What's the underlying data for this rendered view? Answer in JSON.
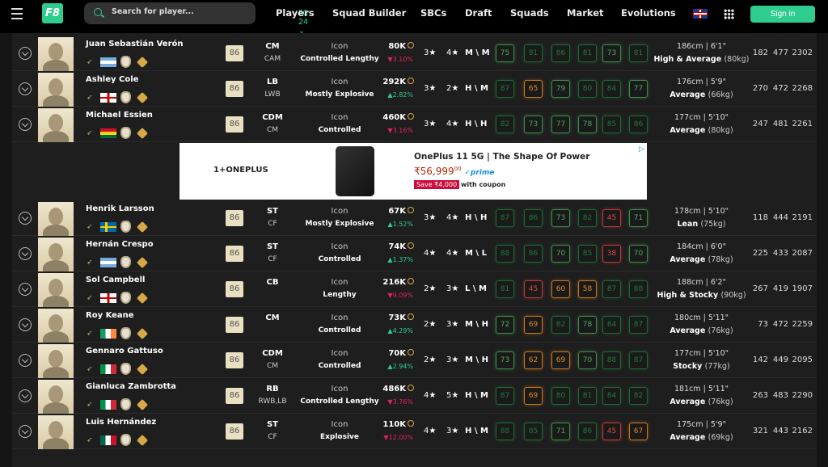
{
  "nav": {
    "logo": "F8",
    "search_placeholder": "Search for player...",
    "game": "FC 24",
    "links": [
      "Players",
      "Squad Builder",
      "SBCs",
      "Draft",
      "Squads",
      "Market",
      "Evolutions"
    ],
    "signin": "Sign in"
  },
  "colors": {
    "accent": "#2ecc8f",
    "up": "#2ecc8f",
    "down": "#e0245e",
    "stat_high": "#1e7a3a",
    "stat_good": "#4cab5a",
    "stat_mid": "#e08a25",
    "stat_low": "#e04848"
  },
  "ad": {
    "brand": "1+ONEPLUS",
    "title": "OnePlus 11 5G | The Shape Of Power",
    "price": "₹56,999",
    "price_cents": "00",
    "prime": "✓prime",
    "save": "Save ₹4,000",
    "coupon": "with coupon",
    "choices": "▷"
  },
  "players": [
    {
      "name": "Juan Sebastián Verón",
      "flag": "ar",
      "rating": "86",
      "pos": "CM",
      "alt": "CAM",
      "card": "Icon",
      "style": "Controlled Lengthy",
      "price": "80K",
      "change": "3.10%",
      "dir": "down",
      "skill": "3★",
      "weak": "4★",
      "wr": "M \\ M",
      "stats": [
        75,
        81,
        86,
        81,
        73,
        81
      ],
      "height": "186cm | 6'1\"",
      "body": "High & Average",
      "weight": "(80kg)",
      "n": [
        "182",
        "477",
        "2302"
      ]
    },
    {
      "name": "Ashley Cole",
      "flag": "en",
      "rating": "86",
      "pos": "LB",
      "alt": "LWB",
      "card": "Icon",
      "style": "Mostly Explosive",
      "price": "292K",
      "change": "2.82%",
      "dir": "up",
      "skill": "3★",
      "weak": "2★",
      "wr": "H \\ M",
      "stats": [
        87,
        65,
        79,
        80,
        84,
        77
      ],
      "height": "176cm | 5'9\"",
      "body": "Average",
      "weight": "(66kg)",
      "n": [
        "270",
        "472",
        "2268"
      ]
    },
    {
      "name": "Michael Essien",
      "flag": "gh",
      "rating": "86",
      "pos": "CDM",
      "alt": "CM",
      "card": "Icon",
      "style": "Controlled",
      "price": "460K",
      "change": "3.16%",
      "dir": "down",
      "skill": "3★",
      "weak": "4★",
      "wr": "H \\ H",
      "stats": [
        82,
        73,
        77,
        78,
        85,
        86
      ],
      "height": "177cm | 5'10\"",
      "body": "Average",
      "weight": "(80kg)",
      "n": [
        "247",
        "481",
        "2261"
      ]
    },
    {
      "name": "Henrik Larsson",
      "flag": "se",
      "rating": "86",
      "pos": "ST",
      "alt": "CF",
      "card": "Icon",
      "style": "Mostly Explosive",
      "price": "67K",
      "change": "1.52%",
      "dir": "up",
      "skill": "3★",
      "weak": "4★",
      "wr": "H \\ H",
      "stats": [
        87,
        86,
        73,
        82,
        45,
        71
      ],
      "height": "178cm | 5'10\"",
      "body": "Lean",
      "weight": "(75kg)",
      "n": [
        "118",
        "444",
        "2191"
      ]
    },
    {
      "name": "Hernán Crespo",
      "flag": "ar",
      "rating": "86",
      "pos": "ST",
      "alt": "CF",
      "card": "Icon",
      "style": "Controlled",
      "price": "74K",
      "change": "1.37%",
      "dir": "up",
      "skill": "4★",
      "weak": "4★",
      "wr": "M \\ L",
      "stats": [
        88,
        86,
        70,
        85,
        38,
        70
      ],
      "height": "184cm | 6'0\"",
      "body": "Average",
      "weight": "(78kg)",
      "n": [
        "225",
        "433",
        "2087"
      ]
    },
    {
      "name": "Sol Campbell",
      "flag": "en",
      "rating": "86",
      "pos": "CB",
      "alt": "",
      "card": "Icon",
      "style": "Lengthy",
      "price": "216K",
      "change": "9.09%",
      "dir": "down",
      "skill": "2★",
      "weak": "3★",
      "wr": "L \\ M",
      "stats": [
        81,
        45,
        60,
        58,
        87,
        88
      ],
      "height": "188cm | 6'2\"",
      "body": "High & Stocky",
      "weight": "(90kg)",
      "n": [
        "267",
        "419",
        "1907"
      ]
    },
    {
      "name": "Roy Keane",
      "flag": "ie",
      "rating": "86",
      "pos": "CM",
      "alt": "",
      "card": "Icon",
      "style": "Controlled",
      "price": "73K",
      "change": "4.29%",
      "dir": "up",
      "skill": "2★",
      "weak": "3★",
      "wr": "M \\ H",
      "stats": [
        72,
        69,
        82,
        78,
        84,
        87
      ],
      "height": "180cm | 5'11\"",
      "body": "Average",
      "weight": "(76kg)",
      "n": [
        "73",
        "472",
        "2259"
      ]
    },
    {
      "name": "Gennaro Gattuso",
      "flag": "it",
      "rating": "86",
      "pos": "CDM",
      "alt": "CM",
      "card": "Icon",
      "style": "Controlled",
      "price": "70K",
      "change": "2.94%",
      "dir": "up",
      "skill": "2★",
      "weak": "3★",
      "wr": "M \\ H",
      "stats": [
        73,
        62,
        69,
        70,
        88,
        87
      ],
      "height": "177cm | 5'10\"",
      "body": "Stocky",
      "weight": "(77kg)",
      "n": [
        "142",
        "449",
        "2095"
      ]
    },
    {
      "name": "Gianluca Zambrotta",
      "flag": "it",
      "rating": "86",
      "pos": "RB",
      "alt": "RWB,LB",
      "card": "Icon",
      "style": "Controlled Lengthy",
      "price": "486K",
      "change": "3.76%",
      "dir": "down",
      "skill": "4★",
      "weak": "5★",
      "wr": "H \\ M",
      "stats": [
        87,
        69,
        80,
        81,
        84,
        82
      ],
      "height": "181cm | 5'11\"",
      "body": "Average",
      "weight": "(76kg)",
      "n": [
        "263",
        "483",
        "2290"
      ]
    },
    {
      "name": "Luis Hernández",
      "flag": "mx",
      "rating": "86",
      "pos": "ST",
      "alt": "CF",
      "card": "Icon",
      "style": "Explosive",
      "price": "110K",
      "change": "12.00%",
      "dir": "down",
      "skill": "4★",
      "weak": "3★",
      "wr": "H \\ M",
      "stats": [
        88,
        85,
        71,
        86,
        45,
        67
      ],
      "height": "175cm | 5'9\"",
      "body": "Average",
      "weight": "(69kg)",
      "n": [
        "321",
        "443",
        "2162"
      ]
    }
  ]
}
